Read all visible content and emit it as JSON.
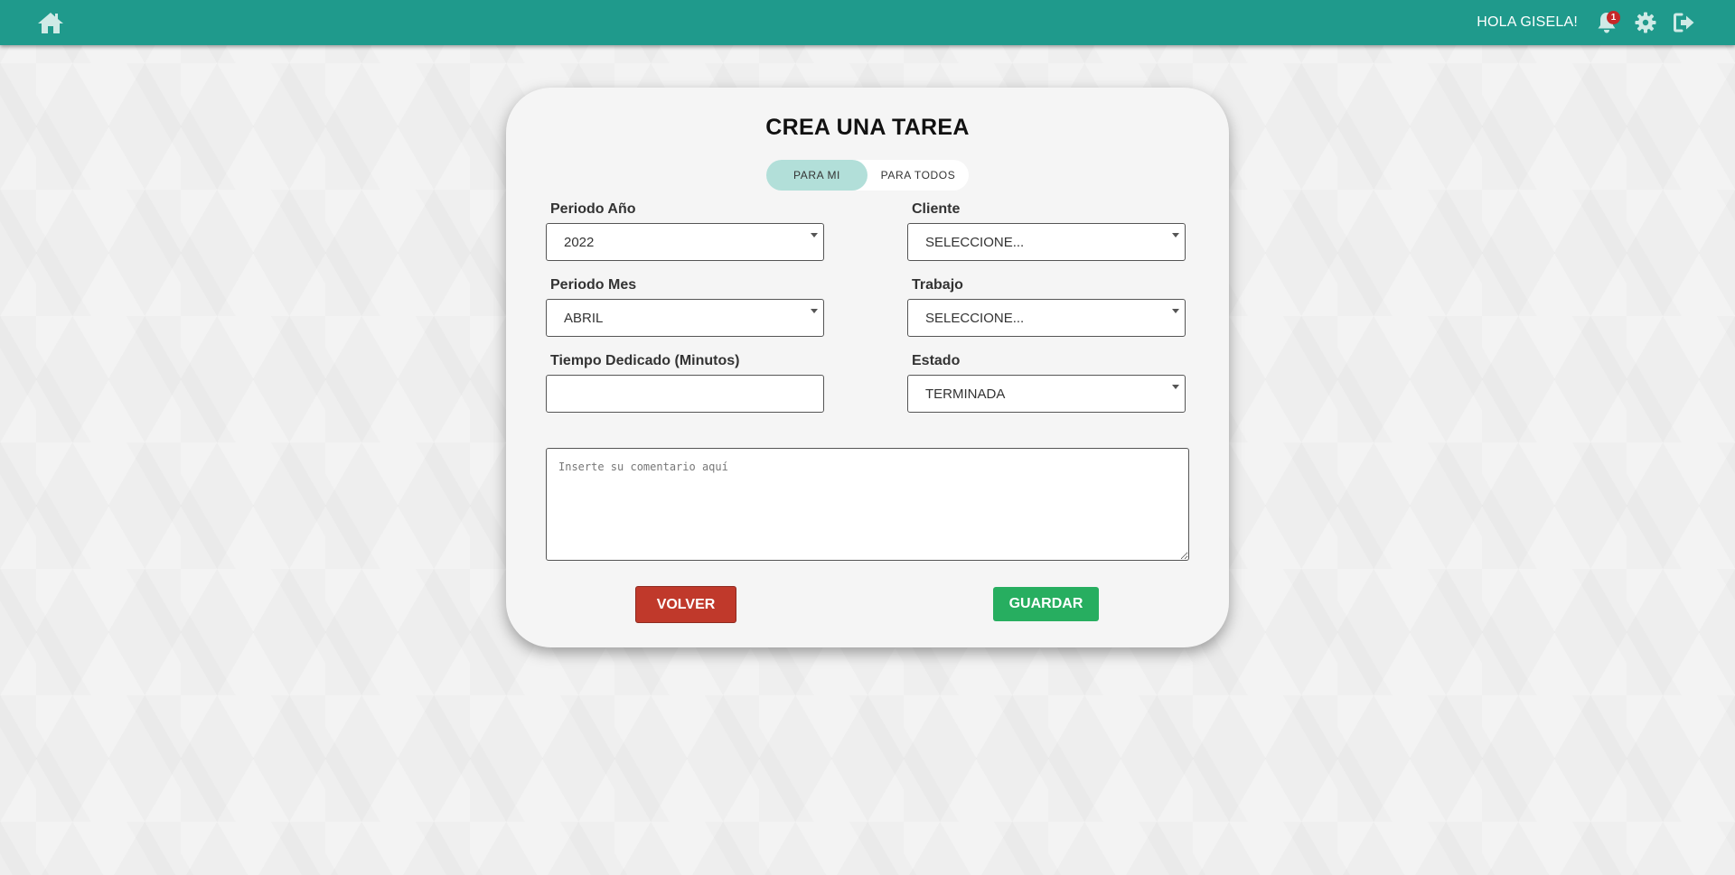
{
  "header": {
    "greeting": "HOLA GISELA!",
    "notification_count": "1",
    "icons": [
      "home-icon",
      "bell-icon",
      "gear-icon",
      "logout-icon"
    ],
    "background_color": "#1f9a8c"
  },
  "form": {
    "title": "CREA UNA TAREA",
    "toggle": {
      "active_label": "PARA MI",
      "inactive_label": "PARA TODOS"
    },
    "fields": {
      "periodo_anio": {
        "label": "Periodo Año",
        "value": "2022"
      },
      "cliente": {
        "label": "Cliente",
        "value": "SELECCIONE..."
      },
      "periodo_mes": {
        "label": "Periodo Mes",
        "value": "ABRIL"
      },
      "trabajo": {
        "label": "Trabajo",
        "value": "SELECCIONE..."
      },
      "tiempo": {
        "label": "Tiempo Dedicado (Minutos)",
        "value": ""
      },
      "estado": {
        "label": "Estado",
        "value": "TERMINADA"
      }
    },
    "comment_placeholder": "Inserte su comentario aquí",
    "buttons": {
      "volver": "VOLVER",
      "guardar": "GUARDAR"
    }
  },
  "colors": {
    "volver": "#c0392b",
    "guardar": "#27ae60",
    "toggle_active": "#b2dfd9"
  }
}
